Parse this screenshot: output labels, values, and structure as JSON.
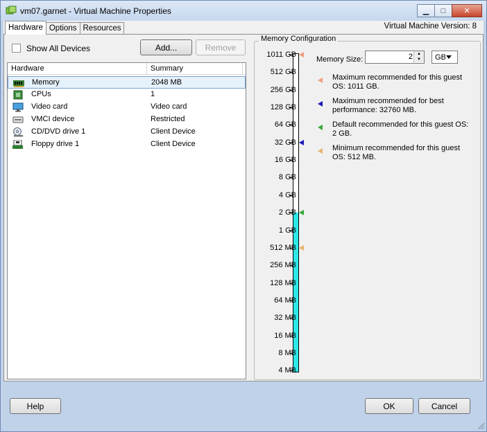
{
  "window": {
    "title": "vm07.garnet - Virtual Machine Properties",
    "minimize_glyph": "▁",
    "maximize_glyph": "□",
    "close_glyph": "✕"
  },
  "tabs": [
    {
      "label": "Hardware",
      "active": true
    },
    {
      "label": "Options",
      "active": false
    },
    {
      "label": "Resources",
      "active": false
    }
  ],
  "vm_version": "Virtual Machine Version: 8",
  "hardware": {
    "show_all_label": "Show All Devices",
    "show_all_checked": false,
    "add_label": "Add...",
    "remove_label": "Remove",
    "columns": {
      "name": "Hardware",
      "summary": "Summary"
    },
    "devices": [
      {
        "name": "Memory",
        "summary": "2048 MB",
        "icon": "memory-icon",
        "selected": true
      },
      {
        "name": "CPUs",
        "summary": "1",
        "icon": "cpu-icon",
        "selected": false
      },
      {
        "name": "Video card",
        "summary": "Video card",
        "icon": "video-card-icon",
        "selected": false
      },
      {
        "name": "VMCI device",
        "summary": "Restricted",
        "icon": "vmci-device-icon",
        "selected": false
      },
      {
        "name": "CD/DVD drive 1",
        "summary": "Client Device",
        "icon": "cd-dvd-icon",
        "selected": false
      },
      {
        "name": "Floppy drive 1",
        "summary": "Client Device",
        "icon": "floppy-icon",
        "selected": false
      }
    ]
  },
  "memory": {
    "group_title": "Memory Configuration",
    "size_label": "Memory Size:",
    "size_value": "2",
    "unit": "GB",
    "scale_labels": [
      "1011 GB",
      "512 GB",
      "256 GB",
      "128 GB",
      "64 GB",
      "32 GB",
      "16 GB",
      "8 GB",
      "4 GB",
      "2 GB",
      "1 GB",
      "512 MB",
      "256 MB",
      "128 MB",
      "64 MB",
      "32 MB",
      "16 MB",
      "8 MB",
      "4 MB"
    ],
    "current_value_gb": 2,
    "markers": [
      {
        "label_index": 0,
        "color": "#f0a080",
        "text": "Maximum recommended for this guest OS: 1011 GB."
      },
      {
        "label_index": 5,
        "color": "#1a1ab8",
        "text": "Maximum recommended for best performance: 32760 MB."
      },
      {
        "label_index": 9,
        "color": "#3aa83a",
        "text": "Default recommended for this guest OS: 2 GB."
      },
      {
        "label_index": 11,
        "color": "#e8b46c",
        "text": "Minimum recommended for this guest OS: 512 MB."
      }
    ],
    "bar_color": "#2ee8e8"
  },
  "footer": {
    "help_label": "Help",
    "ok_label": "OK",
    "cancel_label": "Cancel"
  }
}
